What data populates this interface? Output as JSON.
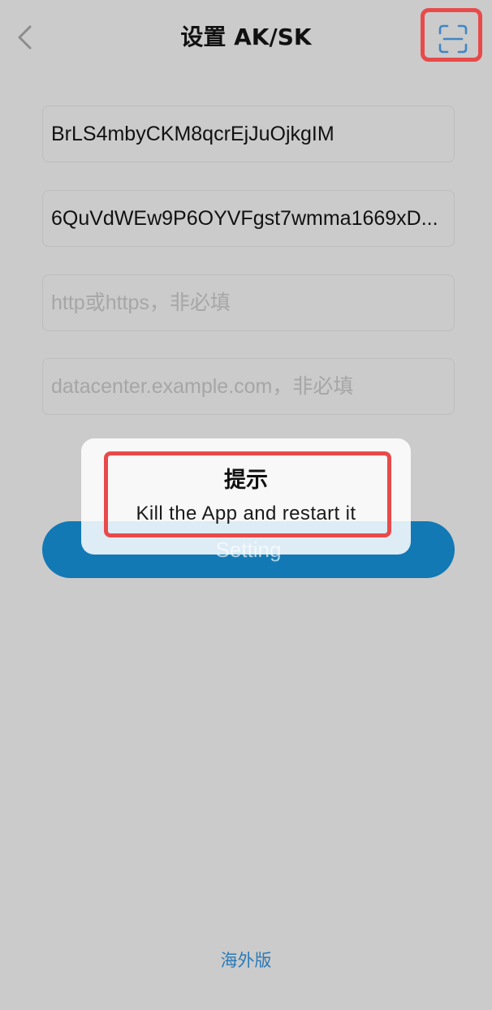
{
  "header": {
    "back_icon": "chevron-left-icon",
    "title": "设置 AK/SK",
    "scan_icon": "scan-icon"
  },
  "form": {
    "access_key": {
      "value": "BrLS4mbyCKM8qcrEjJuOjkgIM"
    },
    "secret_key": {
      "value": "6QuVdWEw9P6OYVFgst7wmma1669xD..."
    },
    "protocol": {
      "value": "",
      "placeholder": "http或https，非必填"
    },
    "host": {
      "value": "",
      "placeholder": "datacenter.example.com，非必填"
    },
    "submit_label": "Setting"
  },
  "toast": {
    "title": "提示",
    "message": "Kill the App and restart it"
  },
  "footer": {
    "region_link": "海外版"
  },
  "colors": {
    "accent": "#1279b5",
    "highlight": "#e84a4a",
    "link": "#2a7ab8",
    "scan_icon": "#3f86c4"
  }
}
